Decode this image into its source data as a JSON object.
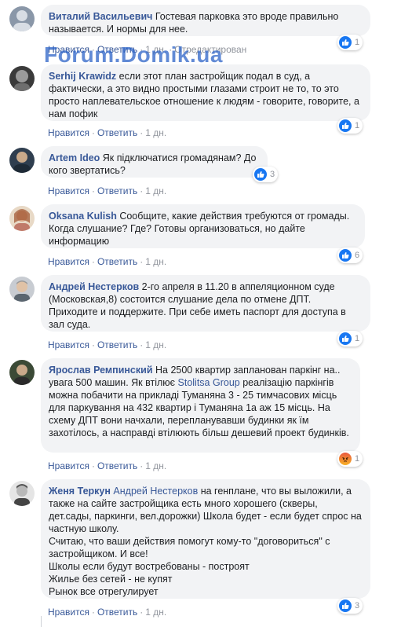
{
  "watermark": "Forum.Domik.ua",
  "comments": [
    {
      "author": "Виталий Васильевич",
      "text": " Гостевая парковка это вроде правильно называется. И нормы для нее.",
      "like": "Нравится",
      "reply": "Ответить",
      "time": "1 дн.",
      "edited": "Отредактирован",
      "reactions": "1"
    },
    {
      "author": "Serhij Krawidz",
      "text": " если этот план застройщик подал в суд, а фактически, а это видно простыми глазами строит не то, то это просто наплевательское отношение к людям - говорите, говорите, а нам пофик",
      "like": "Нравится",
      "reply": "Ответить",
      "time": "1 дн.",
      "reactions": "1"
    },
    {
      "author": "Artem Ideo",
      "text": " Як підключатися громадянам? До кого звертатись?",
      "like": "Нравится",
      "reply": "Ответить",
      "time": "1 дн.",
      "reactions": "3"
    },
    {
      "author": "Oksana Kulish",
      "text": " Сообщите, какие действия требуются от громады. Когда слушание? Где? Готовы организоваться, но дайте информацию",
      "like": "Нравится",
      "reply": "Ответить",
      "time": "1 дн.",
      "reactions": "6"
    },
    {
      "author": "Андрей Нестерков",
      "text": " 2-го апреля в 11.20 в аппеляционном суде (Московская,8) состоится слушание дела по отмене ДПТ. Приходите и поддержите. При себе иметь паспорт для доступа в зал суда.",
      "like": "Нравится",
      "reply": "Ответить",
      "time": "1 дн.",
      "reactions": "1"
    },
    {
      "author": "Ярослав Ремпинский",
      "text_a": " На 2500 квартир запланован паркінг на.. увага 500 машин. Як втілює ",
      "mention": "Stolitsa Group",
      "text_b": " реалізацію паркінгів можна побачити на прикладі Туманяна 3 - 25 тимчасових місць для паркування на 432 квартир і Туманяна 1а аж 15 місць. На схему ДПТ вони начхали, перепланувавши будинки як їм захотілось, а насправді втілюють більш дешевий проект будинків.",
      "like": "Нравится",
      "reply": "Ответить",
      "time": "1 дн.",
      "reactions": "1"
    },
    {
      "author": "Женя Теркун",
      "mention": "Андрей Нестерков",
      "text_a": " на генплане, что вы выложили, а также на сайте застройщика есть много хорошего (скверы, дет.сады, паркинги, вел.дорожки) Школа будет - если будет спрос на частную школу.",
      "text_b": "Считаю, что ваши действия помогут кому-то \"договориться\" с застройщиком. И все!",
      "text_c": "Школы если будут востребованы - построят",
      "text_d": "Жилье без сетей - не купят",
      "text_e": "Рынок все отрегулирует",
      "like": "Нравится",
      "reply": "Ответить",
      "time": "1 дн.",
      "reactions": "3"
    }
  ],
  "icons": {
    "like": "like-thumb-icon",
    "angry": "angry-face-icon"
  },
  "colors": {
    "link": "#385898",
    "bubble": "#f2f3f5",
    "meta": "#90949c",
    "like": "#1877f2",
    "watermark": "#2d64c8"
  }
}
